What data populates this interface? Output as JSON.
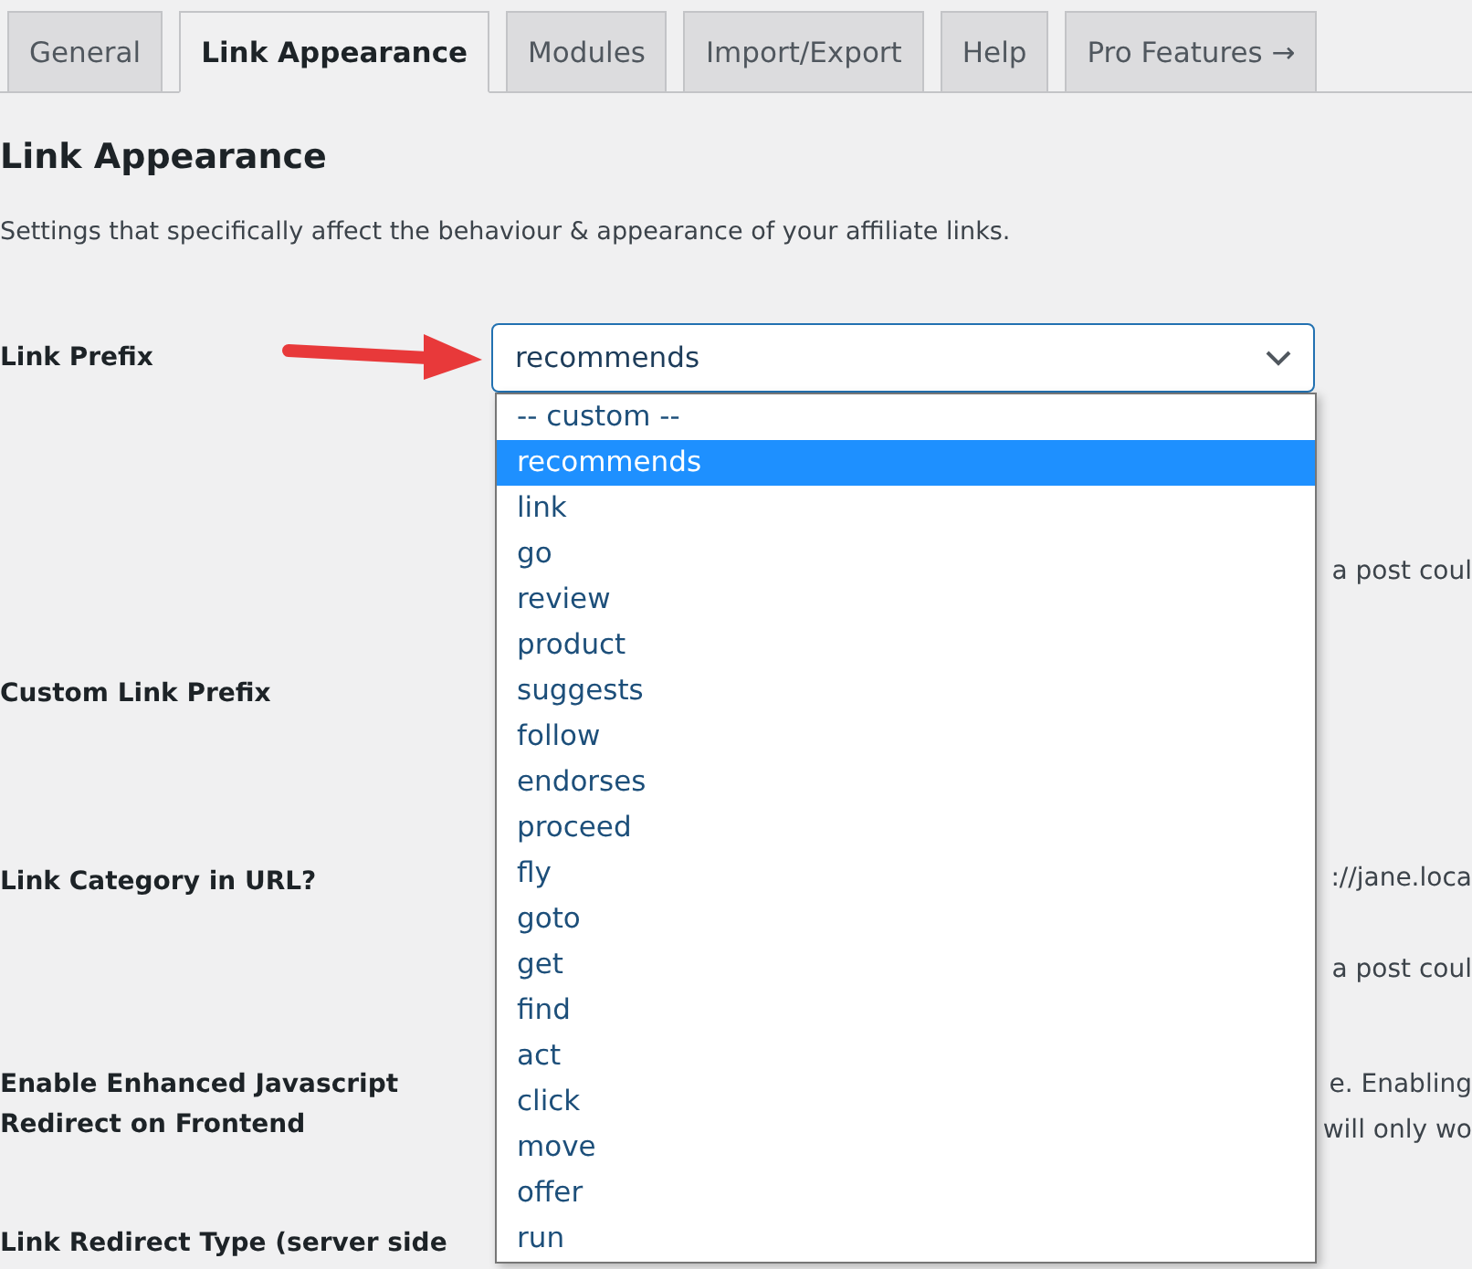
{
  "tabs": [
    {
      "label": "General",
      "selected": false
    },
    {
      "label": "Link Appearance",
      "selected": true
    },
    {
      "label": "Modules",
      "selected": false
    },
    {
      "label": "Import/Export",
      "selected": false
    },
    {
      "label": "Help",
      "selected": false
    },
    {
      "label": "Pro Features →",
      "selected": false
    }
  ],
  "heading": "Link Appearance",
  "description": "Settings that specifically affect the behaviour & appearance of your affiliate links.",
  "settings": [
    {
      "label": "Link Prefix",
      "kind": "select",
      "notes": [
        "a post coul"
      ]
    },
    {
      "label": "Custom Link Prefix",
      "kind": "plain"
    },
    {
      "label": "Link Category in URL?",
      "kind": "plain",
      "notes": [
        "://jane.loca",
        "a post coul"
      ]
    },
    {
      "label": "Enable Enhanced Javascript Redirect on Frontend",
      "kind": "plain",
      "notes": [
        "e. Enabling",
        "will only wo"
      ]
    },
    {
      "label": "Link Redirect Type (server side",
      "kind": "plain"
    }
  ],
  "link_prefix_select": {
    "value": "recommends",
    "expanded": true,
    "options": [
      {
        "label": "-- custom --",
        "selected": false
      },
      {
        "label": "recommends",
        "selected": true
      },
      {
        "label": "link",
        "selected": false
      },
      {
        "label": "go",
        "selected": false
      },
      {
        "label": "review",
        "selected": false
      },
      {
        "label": "product",
        "selected": false
      },
      {
        "label": "suggests",
        "selected": false
      },
      {
        "label": "follow",
        "selected": false
      },
      {
        "label": "endorses",
        "selected": false
      },
      {
        "label": "proceed",
        "selected": false
      },
      {
        "label": "fly",
        "selected": false
      },
      {
        "label": "goto",
        "selected": false
      },
      {
        "label": "get",
        "selected": false
      },
      {
        "label": "find",
        "selected": false
      },
      {
        "label": "act",
        "selected": false
      },
      {
        "label": "click",
        "selected": false
      },
      {
        "label": "move",
        "selected": false
      },
      {
        "label": "offer",
        "selected": false
      },
      {
        "label": "run",
        "selected": false
      }
    ]
  }
}
